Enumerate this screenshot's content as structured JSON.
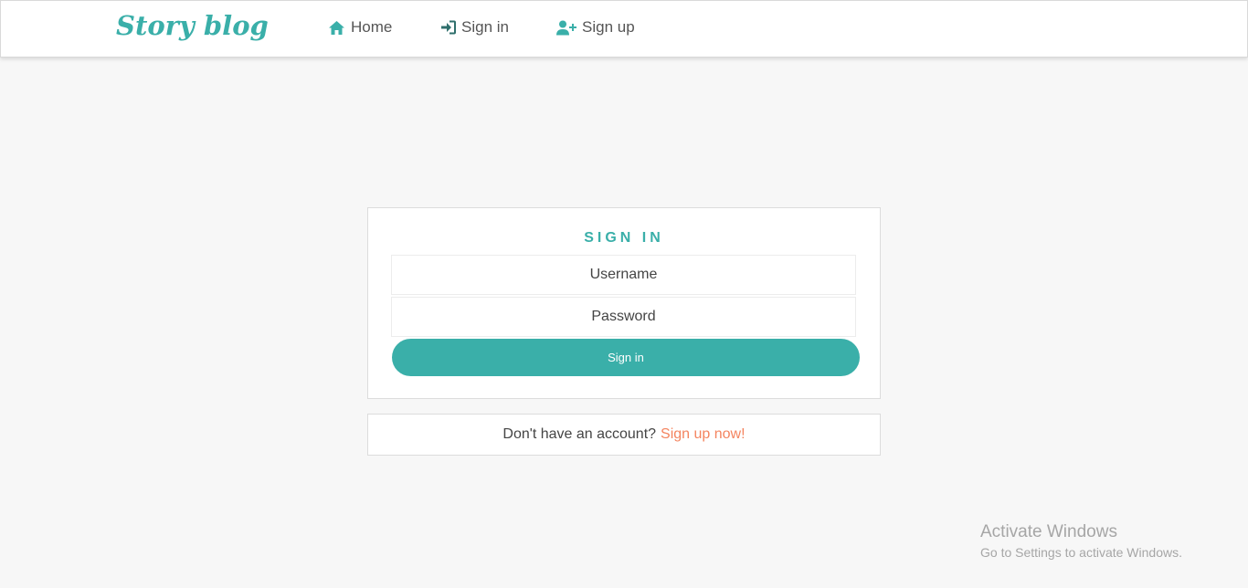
{
  "brand": "Story blog",
  "nav": {
    "home": "Home",
    "sign_in": "Sign in",
    "sign_up": "Sign up"
  },
  "icons": {
    "home": "home-icon",
    "sign_in": "sign-in-icon",
    "sign_up": "user-plus-icon"
  },
  "form": {
    "title": "SIGN IN",
    "username_placeholder": "Username",
    "password_placeholder": "Password",
    "submit_label": "Sign in"
  },
  "signup_prompt": {
    "text": "Don't have an account?",
    "link": "Sign up now!"
  },
  "watermark": {
    "title": "Activate Windows",
    "subtitle": "Go to Settings to activate Windows."
  },
  "colors": {
    "accent": "#3aafa9",
    "link": "#f4845f",
    "background": "#f7f7f7"
  }
}
